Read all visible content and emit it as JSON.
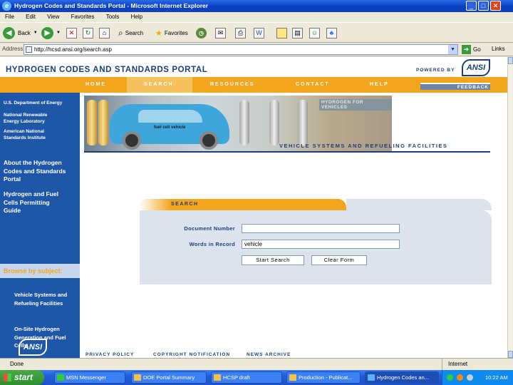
{
  "window": {
    "title": "Hydrogen Codes and Standards Portal - Microsoft Internet Explorer"
  },
  "menu": [
    "File",
    "Edit",
    "View",
    "Favorites",
    "Tools",
    "Help"
  ],
  "toolbar": {
    "back_label": "Back",
    "search_label": "Search",
    "favorites_label": "Favorites"
  },
  "address": {
    "label": "Address",
    "url": "http://hcsd.ansi.org/search.asp",
    "go_label": "Go",
    "links_label": "Links"
  },
  "portal": {
    "title": "HYDROGEN CODES AND STANDARDS PORTAL",
    "powered_by": "POWERED BY",
    "logo_text": "ANSI"
  },
  "nav": {
    "items": [
      "HOME",
      "SEARCH",
      "RESOURCES",
      "CONTACT",
      "HELP"
    ],
    "active": "SEARCH",
    "feedback": "FEEDBACK"
  },
  "sidebar": {
    "partners": [
      "U.S. Department of Energy",
      "National Renewable Energy Laboratory",
      "American National Standards Institute"
    ],
    "links": [
      "About the Hydrogen Codes and Standards Portal",
      "Hydrogen and Fuel Cells Permitting Guide"
    ],
    "browse_label": "Browse by subject:",
    "subjects": [
      "Vehicle Systems and Refueling Facilities",
      "On-Site Hydrogen Generation and Fuel Cells"
    ],
    "logo_text": "ANSI"
  },
  "banner": {
    "sign_text": "HYDROGEN FOR VEHICLES",
    "car_text": "fuel cell vehicle",
    "caption": "VEHICLE SYSTEMS AND REFUELING FACILITIES"
  },
  "search": {
    "header": "SEARCH",
    "doc_number_label": "Document Number",
    "doc_number_value": "",
    "words_label": "Words in Record",
    "words_value": "vehicle",
    "start_button": "Start Search",
    "clear_button": "Clear Form"
  },
  "footer": {
    "links": [
      "PRIVACY POLICY",
      "COPYRIGHT NOTIFICATION",
      "NEWS ARCHIVE"
    ]
  },
  "status": {
    "left": "Done",
    "zone": "Internet"
  },
  "taskbar": {
    "start_label": "start",
    "tasks": [
      "MSN Messenger",
      "DOE Portal Summary",
      "HCSP draft",
      "Production - Publicat...",
      "Hydrogen Codes an..."
    ],
    "clock": "10:22 AM"
  },
  "colors": {
    "nav_orange": "#f2a51d",
    "sidebar_blue": "#1f57a8",
    "title_navy": "#1c3f7a"
  }
}
